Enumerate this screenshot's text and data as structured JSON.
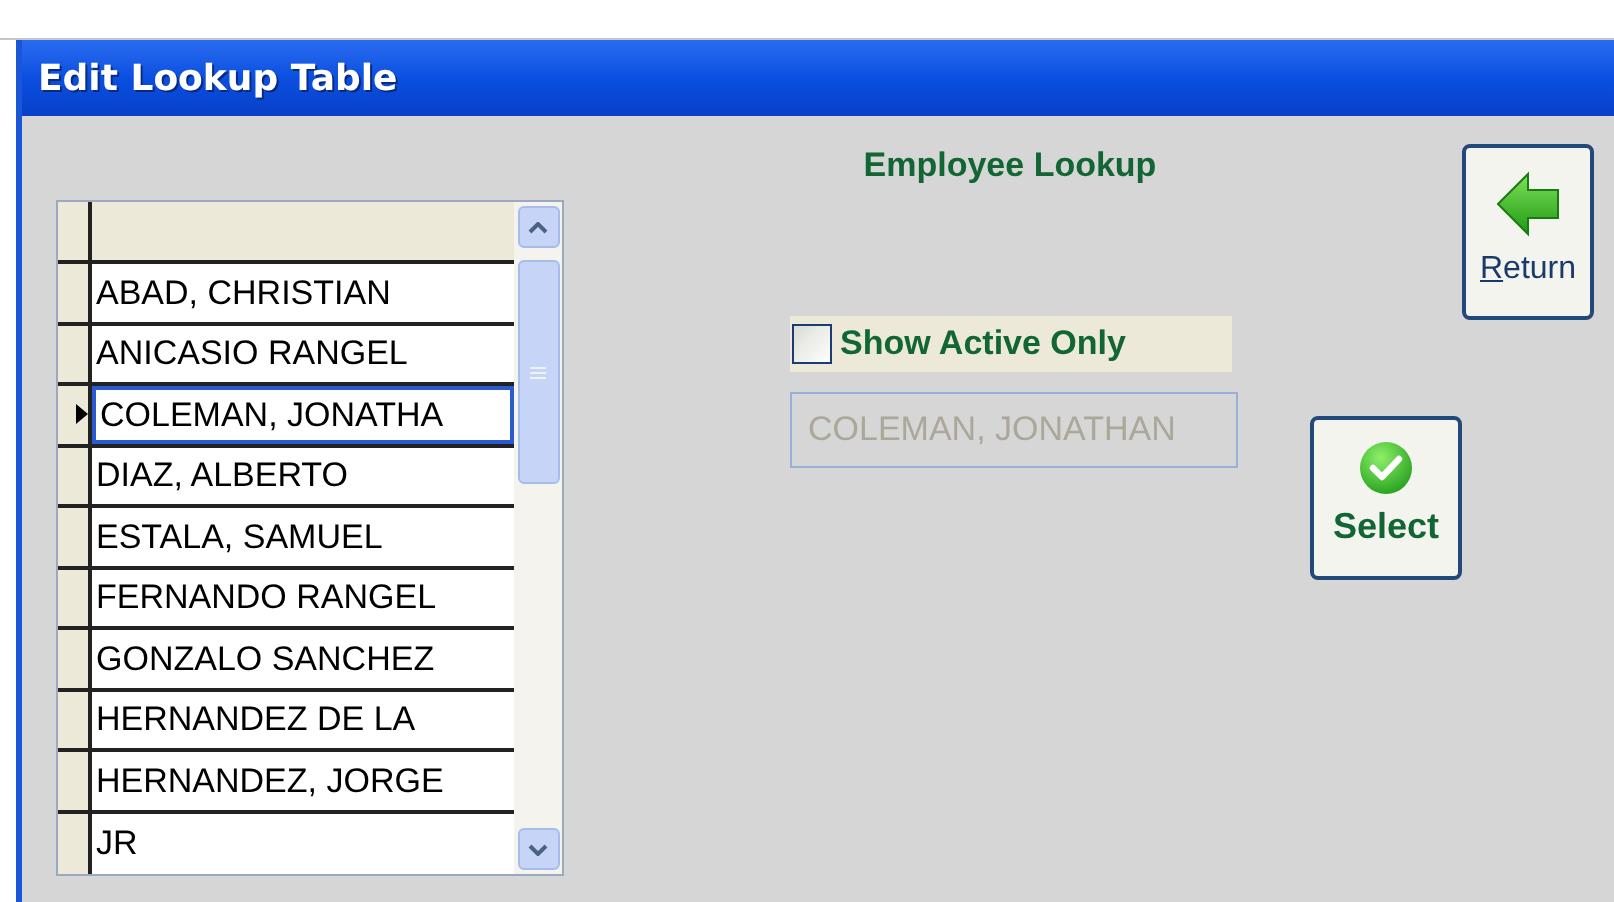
{
  "window": {
    "title": "Edit Lookup Table"
  },
  "heading": "Employee Lookup",
  "grid": {
    "rows": [
      {
        "name": "ABAD, CHRISTIAN",
        "selected": false
      },
      {
        "name": "ANICASIO RANGEL",
        "selected": false
      },
      {
        "name": "COLEMAN, JONATHA",
        "selected": true
      },
      {
        "name": "DIAZ, ALBERTO",
        "selected": false
      },
      {
        "name": "ESTALA, SAMUEL",
        "selected": false
      },
      {
        "name": "FERNANDO RANGEL",
        "selected": false
      },
      {
        "name": "GONZALO SANCHEZ",
        "selected": false
      },
      {
        "name": "HERNANDEZ DE LA",
        "selected": false
      },
      {
        "name": "HERNANDEZ, JORGE",
        "selected": false
      },
      {
        "name": "JR",
        "selected": false
      }
    ]
  },
  "show_active_only": {
    "label": "Show Active Only",
    "checked": false
  },
  "selected_name": {
    "value": "COLEMAN, JONATHAN",
    "disabled": true
  },
  "buttons": [
    {
      "kind": "return",
      "label": "Return",
      "underline_first": true
    },
    {
      "kind": "select",
      "label": "Select"
    }
  ]
}
